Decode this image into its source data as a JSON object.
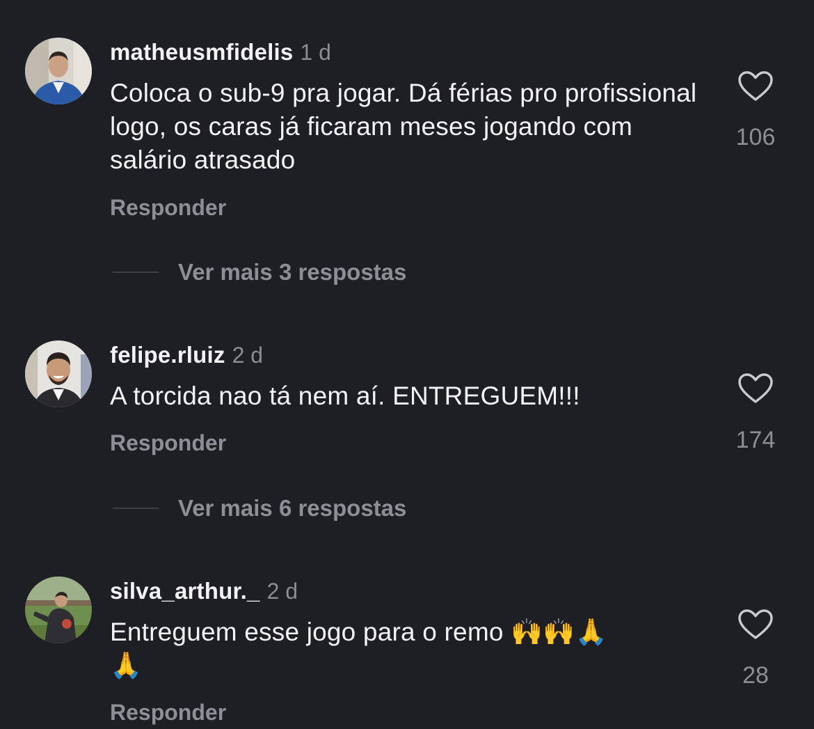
{
  "comments": [
    {
      "username": "matheusmfidelis",
      "time": "1 d",
      "text": "Coloca o sub-9 pra jogar. Dá férias pro profissional logo, os caras já ficaram meses jogando com salário atrasado",
      "likes": "106",
      "reply_label": "Responder",
      "more_replies": "Ver mais 3 respostas"
    },
    {
      "username": "felipe.rluiz",
      "time": "2 d",
      "text": "A torcida nao tá nem aí. ENTREGUEM!!!",
      "likes": "174",
      "reply_label": "Responder",
      "more_replies": "Ver mais 6 respostas"
    },
    {
      "username": "silva_arthur._",
      "time": "2 d",
      "text_line1": "Entreguem esse jogo para o remo 🙌🙌🙏",
      "text_line2": "🙏",
      "likes": "28",
      "reply_label": "Responder"
    }
  ],
  "icons": {
    "like": "heart-outline-icon"
  },
  "colors": {
    "background": "#1e1f25",
    "primary_text": "#f3f3f5",
    "secondary_text": "#8d8f96"
  }
}
